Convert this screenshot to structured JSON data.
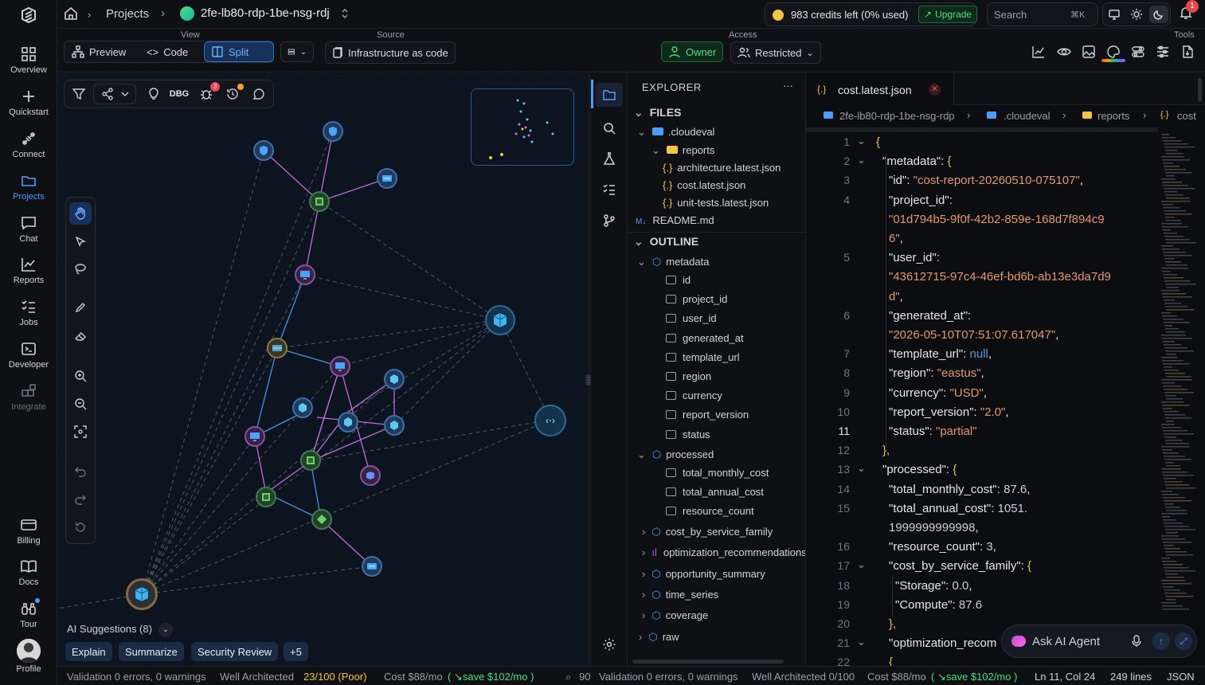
{
  "nav": {
    "overview": "Overview",
    "quickstart": "Quickstart",
    "connect": "Connect",
    "projects": "Projects",
    "chat": "Chat",
    "reports": "Reports",
    "jobs": "Jobs",
    "developer": "Developer",
    "integrate": "Integrate",
    "billing": "Billing",
    "docs": "Docs",
    "tour": "Tour",
    "profile": "Profile"
  },
  "topbar": {
    "breadcrumb_projects": "Projects",
    "project_name": "2fe-lb80-rdp-1be-nsg-rdj",
    "credits": "983 credits left (0% used)",
    "upgrade": "Upgrade",
    "search_placeholder": "Search",
    "search_shortcut": "⌘K",
    "notif_count": "1"
  },
  "toolbar": {
    "view_label": "View",
    "preview": "Preview",
    "code": "Code",
    "split": "Split",
    "source_label": "Source",
    "iac": "Infrastructure as code",
    "access_label": "Access",
    "owner": "Owner",
    "restricted": "Restricted",
    "tools_label": "Tools"
  },
  "canvas": {
    "dbg": "DBG",
    "bug_badge": "3",
    "ai_suggestions": "AI Suggestions (8)",
    "chips": [
      "Explain",
      "Summarize",
      "Security Review",
      "+5"
    ]
  },
  "explorer": {
    "title": "EXPLORER",
    "files": "FILES",
    "folder_cloudeval": ".cloudeval",
    "folder_reports": "reports",
    "file_arch": "architecture.latest.json",
    "file_cost": "cost.latest.json",
    "file_unit": "unit-tests.latest.json",
    "file_readme": "README.md",
    "outline": "OUTLINE",
    "metadata": "metadata",
    "metadata_fields": [
      "id",
      "project_id",
      "user_id",
      "generated_at",
      "template_url",
      "region",
      "currency",
      "report_version",
      "status"
    ],
    "processed": "processed",
    "processed_fields": [
      "total_monthly_cost",
      "total_annual_cost",
      "resource_count"
    ],
    "groups": [
      "cost_by_service_family",
      "optimization_recommendations",
      "opportunity_summary",
      "time_series",
      "coverage",
      "raw"
    ]
  },
  "editor": {
    "tab": "cost.latest.json",
    "crumbs": [
      "2fe-lb80-rdp-1be-nsg-rdp",
      ".cloudeval",
      "reports",
      "cost"
    ],
    "ask_ai": "Ask AI Agent",
    "lines": [
      {
        "n": "1",
        "t": [
          [
            "b",
            "{"
          ]
        ]
      },
      {
        "n": "2",
        "t": [
          [
            "k",
            "\"metadata\": "
          ],
          [
            "b",
            "{"
          ]
        ]
      },
      {
        "n": "3",
        "t": [
          [
            "k",
            "\"id\": "
          ],
          [
            "s",
            "\"cost-report-20260510-075107\""
          ],
          [
            "k",
            ","
          ]
        ]
      },
      {
        "n": "4",
        "t": [
          [
            "k",
            "\"project_id\":"
          ]
        ]
      },
      {
        "n": "",
        "t": [
          [
            "s",
            "\"01d794b5-9f0f-42b2-859e-168d7f894c9"
          ]
        ]
      },
      {
        "n": "",
        "t": [
          [
            "s",
            "6\""
          ],
          [
            "k",
            ","
          ]
        ]
      },
      {
        "n": "5",
        "t": [
          [
            "k",
            "\"user_id\":"
          ]
        ]
      },
      {
        "n": "",
        "t": [
          [
            "s",
            "\"43612715-97c4-46ef-bd6b-ab13e3da7d9"
          ]
        ]
      },
      {
        "n": "",
        "t": [
          [
            "s",
            "d\""
          ],
          [
            "k",
            ","
          ]
        ]
      },
      {
        "n": "6",
        "t": [
          [
            "k",
            "\"generated_at\":"
          ]
        ]
      },
      {
        "n": "",
        "t": [
          [
            "s",
            "\"2026-05-10T07:51:07.617047\""
          ],
          [
            "k",
            ","
          ]
        ]
      },
      {
        "n": "7",
        "t": [
          [
            "k",
            "\"template_url\": "
          ],
          [
            "kw",
            "null"
          ],
          [
            "k",
            ","
          ]
        ]
      },
      {
        "n": "8",
        "t": [
          [
            "k",
            "\"region\": "
          ],
          [
            "s",
            "\"eastus\""
          ],
          [
            "k",
            ","
          ]
        ]
      },
      {
        "n": "9",
        "t": [
          [
            "k",
            "\"currency\": "
          ],
          [
            "s",
            "\"USD\""
          ],
          [
            "k",
            ","
          ]
        ]
      },
      {
        "n": "10",
        "t": [
          [
            "k",
            "\"report_version\": "
          ],
          [
            "s",
            "\"2.0\""
          ],
          [
            "k",
            ","
          ]
        ]
      },
      {
        "n": "11",
        "t": [
          [
            "k",
            "\"status\": "
          ],
          [
            "s",
            "\"partial\""
          ]
        ]
      },
      {
        "n": "12",
        "t": [
          [
            "b",
            "},"
          ]
        ]
      },
      {
        "n": "13",
        "t": [
          [
            "k",
            "\"processed\": "
          ],
          [
            "b",
            "{"
          ]
        ]
      },
      {
        "n": "14",
        "t": [
          [
            "k",
            "\"total_monthly_cost\": "
          ],
          [
            "n",
            "87.6"
          ],
          [
            "k",
            ","
          ]
        ]
      },
      {
        "n": "15",
        "t": [
          [
            "k",
            "\"total_annual_cost\": "
          ],
          [
            "n",
            "1051."
          ]
        ]
      },
      {
        "n": "",
        "t": [
          [
            "n",
            "1999999999998"
          ],
          [
            "k",
            ","
          ]
        ]
      },
      {
        "n": "16",
        "t": [
          [
            "k",
            "\"resource_count\": "
          ],
          [
            "n",
            "3"
          ],
          [
            "k",
            ","
          ]
        ]
      },
      {
        "n": "17",
        "t": [
          [
            "k",
            "\"cost_by_service_family\": "
          ],
          [
            "b",
            "{"
          ]
        ]
      },
      {
        "n": "18",
        "t": [
          [
            "k",
            "\"Storage\": "
          ],
          [
            "n",
            "0.0"
          ],
          [
            "k",
            ","
          ]
        ]
      },
      {
        "n": "19",
        "t": [
          [
            "k",
            "\"Compute\": "
          ],
          [
            "n",
            "87.6"
          ]
        ]
      },
      {
        "n": "20",
        "t": [
          [
            "b",
            "},"
          ]
        ]
      },
      {
        "n": "21",
        "t": [
          [
            "k",
            "\"optimization_recom"
          ]
        ]
      },
      {
        "n": "22",
        "t": [
          [
            "b",
            "{"
          ]
        ]
      }
    ]
  },
  "status": {
    "validation": "Validation 0 errors, 0 warnings",
    "wa_label": "Well Architected",
    "wa_score": "23/100 (Poor)",
    "cost": "Cost $88/mo",
    "save": "( ↘save $102/mo )",
    "zoom": "90",
    "validation2": "Validation 0 errors, 0 warnings",
    "wa2": "Well Architected 0/100",
    "cost2": "Cost $88/mo",
    "save2": "( ↘save $102/mo )",
    "cursor": "Ln 11, Col 24",
    "lines": "249 lines",
    "lang": "JSON"
  },
  "colors": {
    "accent": "#4c9cff",
    "save_green": "#4ade80",
    "poor_yellow": "#f5c542",
    "owner_green": "#22c55e"
  }
}
